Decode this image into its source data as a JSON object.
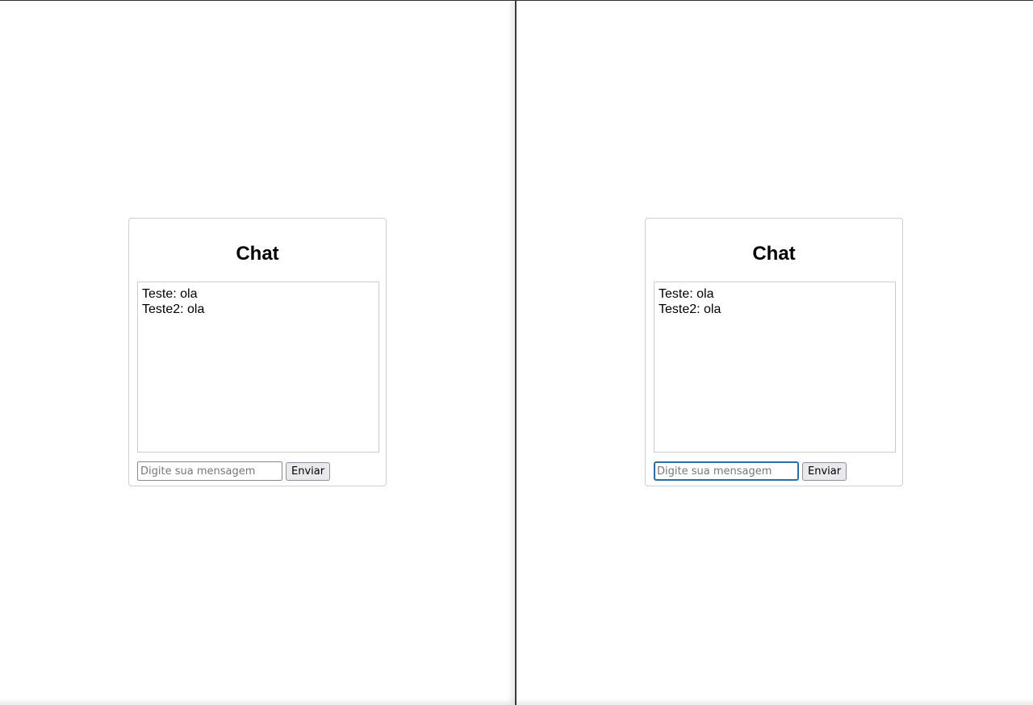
{
  "panes": [
    {
      "title": "Chat",
      "messages": [
        "Teste: ola",
        "Teste2: ola"
      ],
      "input": {
        "value": "",
        "placeholder": "Digite sua mensagem",
        "focused": false
      },
      "send_label": "Enviar"
    },
    {
      "title": "Chat",
      "messages": [
        "Teste: ola",
        "Teste2: ola"
      ],
      "input": {
        "value": "",
        "placeholder": "Digite sua mensagem",
        "focused": true
      },
      "send_label": "Enviar"
    }
  ],
  "colors": {
    "focus_ring": "#1f6fbf",
    "card_border": "#cfcfcf",
    "button_bg": "#e9e9ed"
  }
}
